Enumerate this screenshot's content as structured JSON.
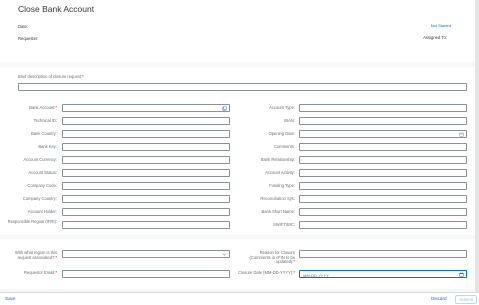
{
  "header": {
    "title": "Close Bank Account",
    "date_label": "Date:",
    "requester_label": "Requester:",
    "status": "Not Started",
    "assigned_label": "Assigned To:"
  },
  "description": {
    "label": "Brief description of closure request:",
    "required": "*"
  },
  "left_fields": [
    {
      "label": "Bank Account:",
      "required": "*",
      "icon": "value-help-icon"
    },
    {
      "label": "Technical ID:",
      "required": ""
    },
    {
      "label": "Bank Country:",
      "required": ""
    },
    {
      "label": "Bank Key:",
      "required": ""
    },
    {
      "label": "Account Currency:",
      "required": ""
    },
    {
      "label": "Account Status:",
      "required": ""
    },
    {
      "label": "Company Code:",
      "required": ""
    },
    {
      "label": "Company Country:",
      "required": ""
    },
    {
      "label": "Account Holder:",
      "required": ""
    },
    {
      "label": "Responsible Region (IFRI):",
      "required": ""
    }
  ],
  "right_fields": [
    {
      "label": "Account Type:",
      "required": ""
    },
    {
      "label": "IBAN:",
      "required": ""
    },
    {
      "label": "Opening Date:",
      "required": "",
      "icon": "calendar-icon"
    },
    {
      "label": "Comments:",
      "required": ""
    },
    {
      "label": "Bank Relationship:",
      "required": ""
    },
    {
      "label": "Account Activity:",
      "required": ""
    },
    {
      "label": "Funding Type:",
      "required": ""
    },
    {
      "label": "Reconciliation Sys:",
      "required": ""
    },
    {
      "label": "Bank Short Name:",
      "required": ""
    },
    {
      "label": "SWIFT/BIC:",
      "required": ""
    }
  ],
  "bottom": {
    "region_label": "With what region is this request associated?:",
    "region_required": "*",
    "reason_label": "Reason for Closure (Comments in cFIN to be updated):",
    "reason_required": "*",
    "email_label": "Requestor Email:",
    "email_required": "*",
    "closure_label": "Closure Date (MM-DD-YYYY):",
    "closure_required": "*",
    "closure_placeholder": "MM-DD-YYYY"
  },
  "footer": {
    "save": "Save",
    "discard": "Discard",
    "submit": "Submit"
  },
  "colors": {
    "link": "#0a6ed1",
    "required": "#bb0000",
    "input_border": "#89919a"
  }
}
